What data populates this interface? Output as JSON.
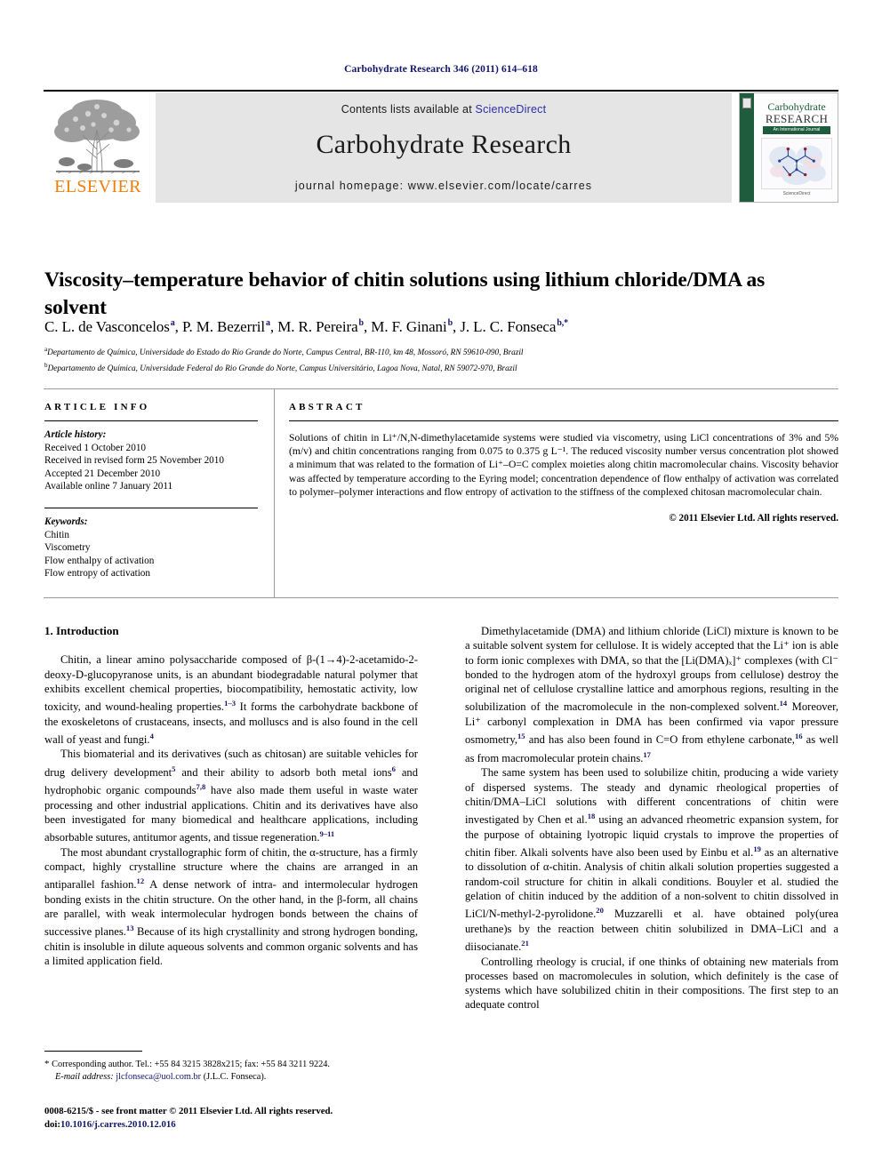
{
  "running_head": "Carbohydrate Research 346 (2011) 614–618",
  "header": {
    "contents_prefix": "Contents lists available at ",
    "sciencedirect": "ScienceDirect",
    "journal_name": "Carbohydrate Research",
    "homepage": "journal homepage: www.elsevier.com/locate/carres",
    "publisher_logo_text": "ELSEVIER",
    "accent_orange": "#f07f09",
    "link_blue": "#2b2fa5",
    "band_grey": "#e5e5e5"
  },
  "cover": {
    "line1": "Carbohydrate",
    "line2": "RESEARCH",
    "subbar": "An International Journal",
    "footer": "ScienceDirect",
    "spine_green": "#1f5c3d"
  },
  "title": "Viscosity–temperature behavior of chitin solutions using lithium chloride/DMA as solvent",
  "authors": [
    {
      "name": "C. L. de Vasconcelos",
      "mark": "a",
      "sep": ", "
    },
    {
      "name": "P. M. Bezerril",
      "mark": "a",
      "sep": ", "
    },
    {
      "name": "M. R. Pereira",
      "mark": "b",
      "sep": ", "
    },
    {
      "name": "M. F. Ginani",
      "mark": "b",
      "sep": ", "
    },
    {
      "name": "J. L. C. Fonseca",
      "mark": "b,*",
      "sep": ""
    }
  ],
  "affiliations": [
    {
      "mark": "a",
      "text": "Departamento de Química, Universidade do Estado do Rio Grande do Norte, Campus Central, BR-110, km 48, Mossoró, RN 59610-090, Brazil"
    },
    {
      "mark": "b",
      "text": "Departamento de Química, Universidade Federal do Rio Grande do Norte, Campus Universitário, Lagoa Nova, Natal, RN 59072-970, Brazil"
    }
  ],
  "article_info": {
    "heading": "ARTICLE INFO",
    "history_label": "Article history:",
    "history": [
      "Received 1 October 2010",
      "Received in revised form 25 November 2010",
      "Accepted 21 December 2010",
      "Available online 7 January 2011"
    ],
    "keywords_label": "Keywords:",
    "keywords": [
      "Chitin",
      "Viscometry",
      "Flow enthalpy of activation",
      "Flow entropy of activation"
    ]
  },
  "abstract": {
    "heading": "ABSTRACT",
    "text": "Solutions of chitin in Li⁺/N,N-dimethylacetamide systems were studied via viscometry, using LiCl concentrations of 3% and 5% (m/v) and chitin concentrations ranging from 0.075 to 0.375 g L⁻¹. The reduced viscosity number versus concentration plot showed a minimum that was related to the formation of Li⁺–O=C complex moieties along chitin macromolecular chains. Viscosity behavior was affected by temperature according to the Eyring model; concentration dependence of flow enthalpy of activation was correlated to polymer–polymer interactions and flow entropy of activation to the stiffness of the complexed chitosan macromolecular chain.",
    "copyright": "© 2011 Elsevier Ltd. All rights reserved."
  },
  "body": {
    "section_heading": "1. Introduction",
    "left_paragraphs": [
      "Chitin, a linear amino polysaccharide composed of β-(1→4)-2-acetamido-2-deoxy-D-glucopyranose units, is an abundant biodegradable natural polymer that exhibits excellent chemical properties, biocompatibility, hemostatic activity, low toxicity, and wound-healing properties.[1–3] It forms the carbohydrate backbone of the exoskeletons of crustaceans, insects, and molluscs and is also found in the cell wall of yeast and fungi.[4]",
      "This biomaterial and its derivatives (such as chitosan) are suitable vehicles for drug delivery development[5] and their ability to adsorb both metal ions[6] and hydrophobic organic compounds[7,8] have also made them useful in waste water processing and other industrial applications. Chitin and its derivatives have also been investigated for many biomedical and healthcare applications, including absorbable sutures, antitumor agents, and tissue regeneration.[9–11]",
      "The most abundant crystallographic form of chitin, the α-structure, has a firmly compact, highly crystalline structure where the chains are arranged in an antiparallel fashion.[12] A dense network of intra- and intermolecular hydrogen bonding exists in the chitin structure. On the other hand, in the β-form, all chains are parallel, with weak intermolecular hydrogen bonds between the chains of successive planes.[13] Because of its high crystallinity and strong hydrogen bonding, chitin is insoluble in dilute aqueous solvents and common organic solvents and has a limited application field."
    ],
    "right_paragraphs": [
      "Dimethylacetamide (DMA) and lithium chloride (LiCl) mixture is known to be a suitable solvent system for cellulose. It is widely accepted that the Li⁺ ion is able to form ionic complexes with DMA, so that the [Li(DMA)ₓ]⁺ complexes (with Cl⁻ bonded to the hydrogen atom of the hydroxyl groups from cellulose) destroy the original net of cellulose crystalline lattice and amorphous regions, resulting in the solubilization of the macromolecule in the non-complexed solvent.[14] Moreover, Li⁺ carbonyl complexation in DMA has been confirmed via vapor pressure osmometry,[15] and has also been found in C=O from ethylene carbonate,[16] as well as from macromolecular protein chains.[17]",
      "The same system has been used to solubilize chitin, producing a wide variety of dispersed systems. The steady and dynamic rheological properties of chitin/DMA–LiCl solutions with different concentrations of chitin were investigated by Chen et al.[18] using an advanced rheometric expansion system, for the purpose of obtaining lyotropic liquid crystals to improve the properties of chitin fiber. Alkali solvents have also been used by Einbu et al.[19] as an alternative to dissolution of α-chitin. Analysis of chitin alkali solution properties suggested a random-coil structure for chitin in alkali conditions. Bouyler et al. studied the gelation of chitin induced by the addition of a non-solvent to chitin dissolved in LiCl/N-methyl-2-pyrolidone.[20] Muzzarelli et al. have obtained poly(urea urethane)s by the reaction between chitin solubilized in DMA–LiCl and a diisocianate.[21]",
      "Controlling rheology is crucial, if one thinks of obtaining new materials from processes based on macromolecules in solution, which definitely is the case of systems which have solubilized chitin in their compositions. The first step to an adequate control"
    ]
  },
  "footnote": {
    "star": "*",
    "corresponding": "Corresponding author. Tel.: +55 84 3215 3828x215; fax: +55 84 3211 9224.",
    "email_label": "E-mail address:",
    "email": "jlcfonseca@uol.com.br",
    "email_owner": "(J.L.C. Fonseca)."
  },
  "colophon": {
    "issn_line": "0008-6215/$ - see front matter © 2011 Elsevier Ltd. All rights reserved.",
    "doi_label": "doi:",
    "doi": "10.1016/j.carres.2010.12.016"
  }
}
